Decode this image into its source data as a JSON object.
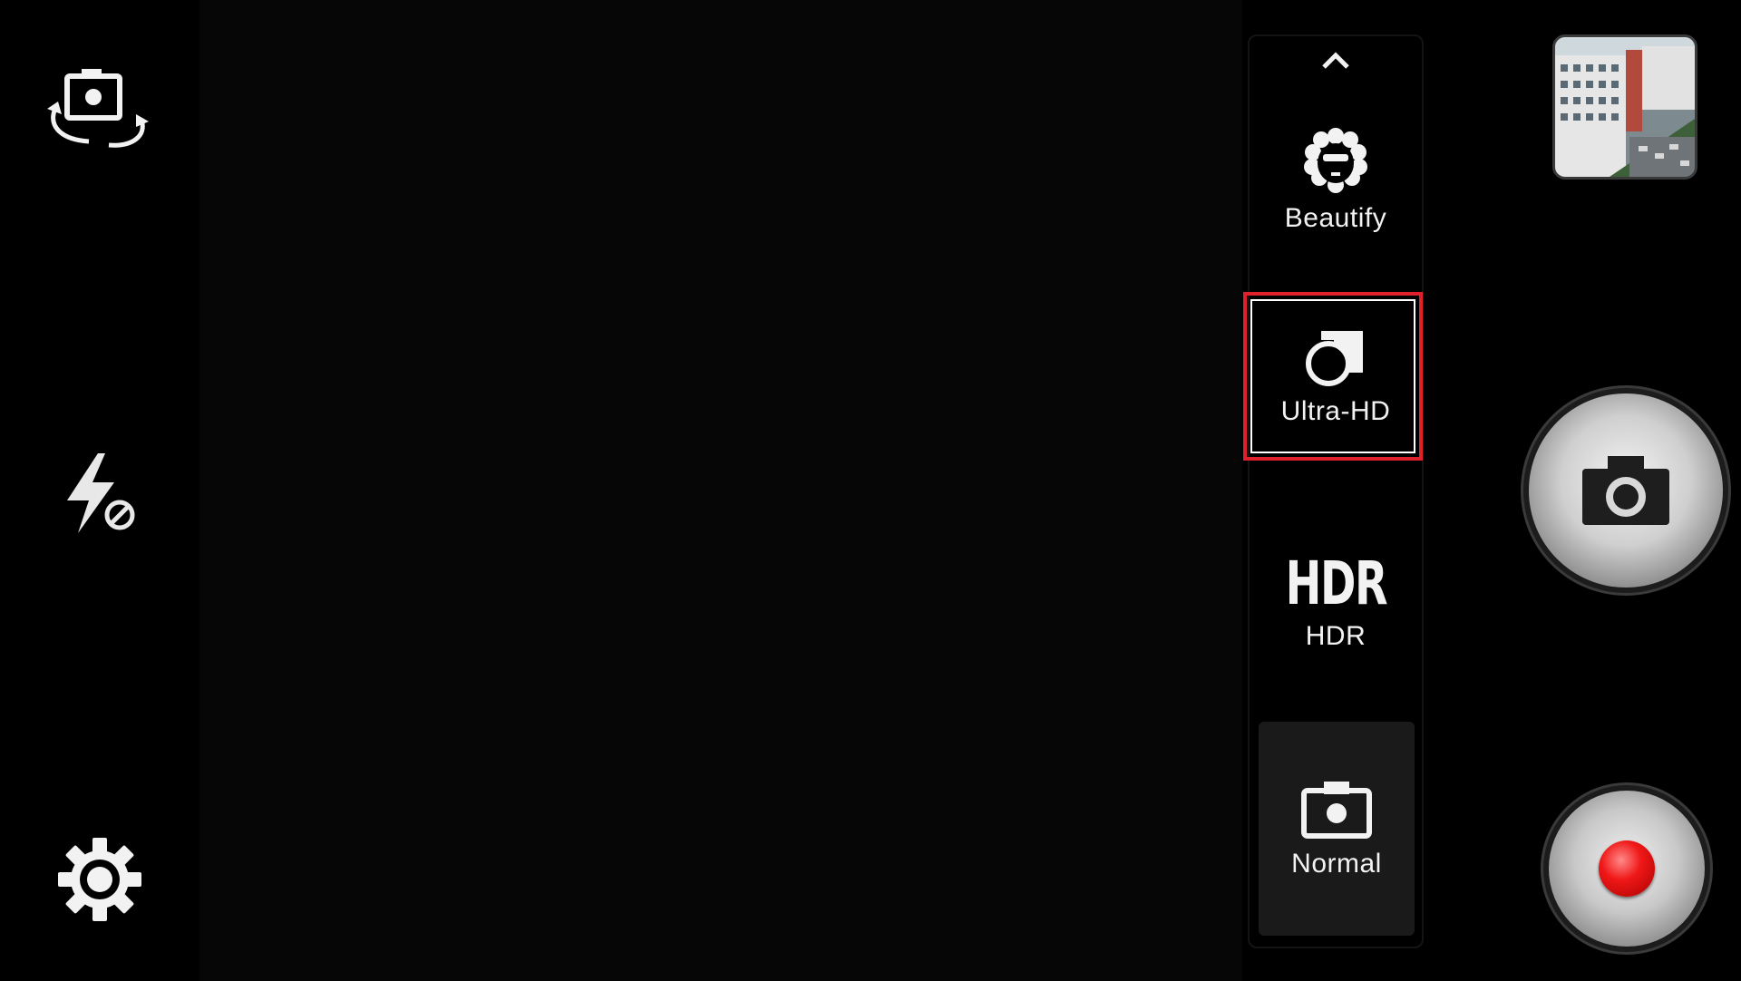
{
  "left_controls": {
    "switch_camera_icon": "camera-switch-icon",
    "flash_icon": "flash-off-icon",
    "settings_icon": "gear-icon"
  },
  "mode_strip": {
    "scroll_up_icon": "chevron-up-icon",
    "modes": [
      {
        "label": "Beautify",
        "icon": "beautify-face-icon"
      },
      {
        "label": "Ultra-HD",
        "icon": "ultra-hd-icon",
        "highlighted": true
      },
      {
        "label": "HDR",
        "icon_text": "HDR"
      },
      {
        "label": "Normal",
        "icon": "camera-icon",
        "selected": true
      }
    ]
  },
  "right_controls": {
    "gallery_thumbnail": "gallery-thumbnail",
    "shutter_icon": "camera-icon",
    "record_icon": "record-dot-icon"
  },
  "colors": {
    "highlight": "#e0202a",
    "record": "#f01818",
    "background": "#000000"
  }
}
